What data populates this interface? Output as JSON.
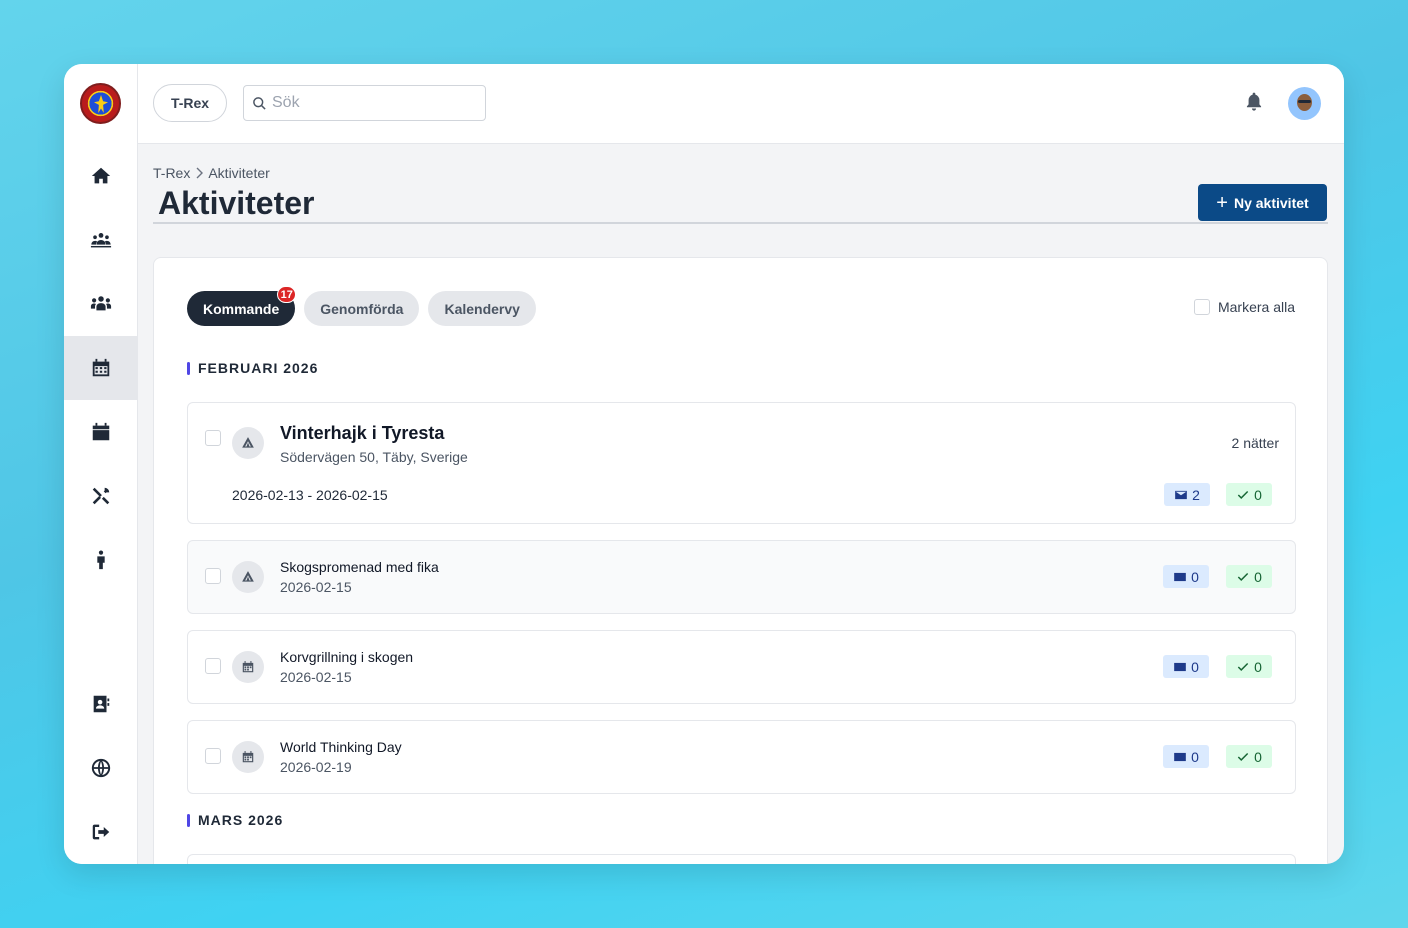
{
  "topbar": {
    "org_label": "T-Rex",
    "search_placeholder": "Sök"
  },
  "sidebar": {
    "items": [
      {
        "name": "home"
      },
      {
        "name": "groups"
      },
      {
        "name": "members"
      },
      {
        "name": "activities",
        "active": true
      },
      {
        "name": "calendar"
      },
      {
        "name": "tools"
      },
      {
        "name": "scout"
      },
      {
        "name": "contacts"
      },
      {
        "name": "language"
      },
      {
        "name": "logout"
      }
    ]
  },
  "breadcrumb": {
    "root": "T-Rex",
    "current": "Aktiviteter"
  },
  "page": {
    "title": "Aktiviteter",
    "new_button_label": "Ny aktivitet"
  },
  "tabs": [
    {
      "label": "Kommande",
      "badge": "17",
      "active": true
    },
    {
      "label": "Genomförda"
    },
    {
      "label": "Kalendervy"
    }
  ],
  "select_all_label": "Markera alla",
  "months": [
    {
      "label": "FEBRUARI 2026",
      "activities": [
        {
          "title": "Vinterhajk i Tyresta",
          "subtitle": "Södervägen 50, Täby, Sverige",
          "dates": "2026-02-13 - 2026-02-15",
          "nights": "2 nätter",
          "invites": "2",
          "accepted": "0",
          "icon": "tent-icon"
        },
        {
          "title": "Skogspromenad med fika",
          "subtitle": "2026-02-15",
          "invites": "0",
          "accepted": "0",
          "icon": "tent-icon"
        },
        {
          "title": "Korvgrillning i skogen",
          "subtitle": "2026-02-15",
          "invites": "0",
          "accepted": "0",
          "icon": "calendar-icon"
        },
        {
          "title": "World Thinking Day",
          "subtitle": "2026-02-19",
          "invites": "0",
          "accepted": "0",
          "icon": "calendar-icon"
        }
      ]
    },
    {
      "label": "MARS 2026",
      "activities": []
    }
  ],
  "colors": {
    "primary_button": "#0b4a87",
    "active_tab": "#1f2937",
    "badge": "#dc2626",
    "month_marker": "#4f46e5"
  }
}
